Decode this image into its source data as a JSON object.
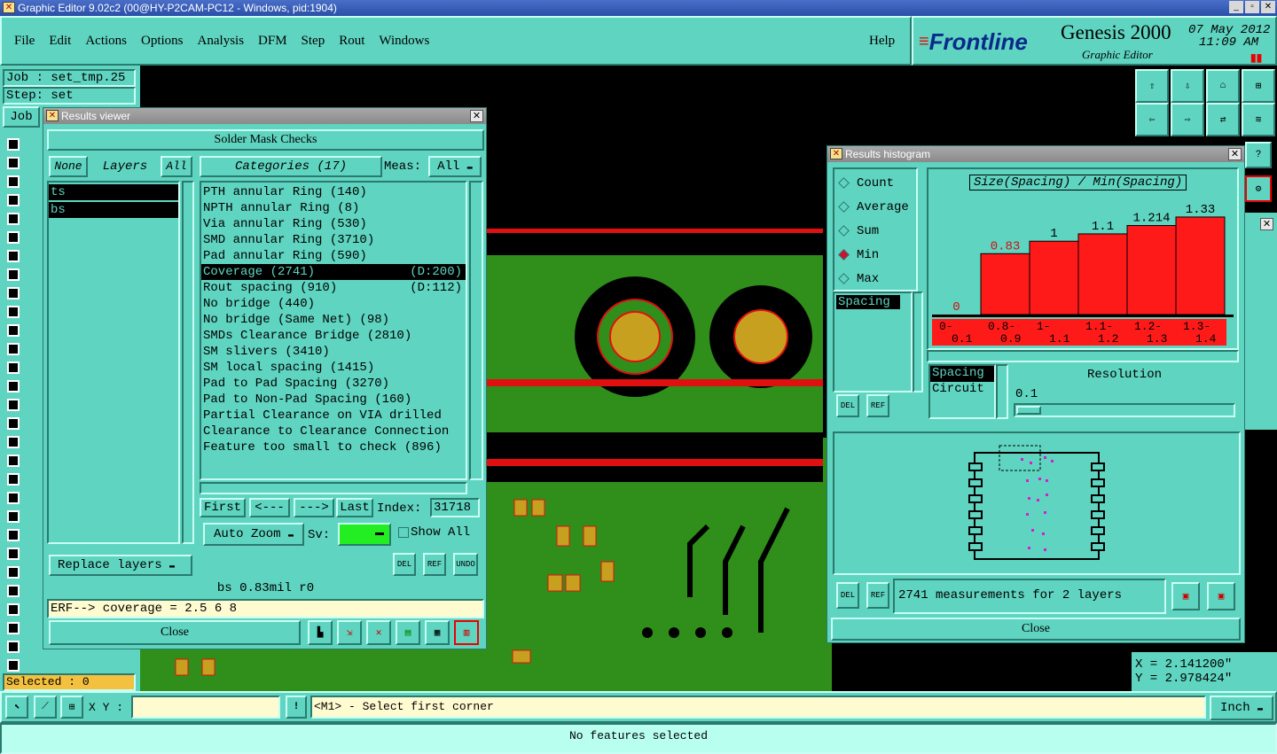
{
  "window_title": "Graphic Editor 9.02c2 (00@HY-P2CAM-PC12 - Windows, pid:1904)",
  "menu": [
    "File",
    "Edit",
    "Actions",
    "Options",
    "Analysis",
    "DFM",
    "Step",
    "Rout",
    "Windows"
  ],
  "help": "Help",
  "brand": {
    "logo": "Frontline",
    "product": "Genesis 2000",
    "subtitle": "Graphic Editor",
    "date": "07 May 2012",
    "time": "11:09 AM"
  },
  "job_label": "Job : set_tmp.25",
  "step_label": "Step: set",
  "job_btn": "Job",
  "selected": "Selected : 0",
  "coords": {
    "x": "X = 2.141200\"",
    "y": "Y = 2.978424\""
  },
  "results_viewer": {
    "title": "Results viewer",
    "header": "Solder Mask Checks",
    "none_btn": "None",
    "layers_label": "Layers",
    "all_btn": "All",
    "layers": [
      "ts",
      "bs"
    ],
    "categories_label": "Categories (17)",
    "meas_label": "Meas:",
    "meas_value": "All",
    "categories": [
      {
        "name": "PTH annular Ring (140)",
        "extra": ""
      },
      {
        "name": "NPTH annular Ring (8)",
        "extra": ""
      },
      {
        "name": "Via annular Ring (530)",
        "extra": ""
      },
      {
        "name": "SMD annular Ring (3710)",
        "extra": ""
      },
      {
        "name": "Pad annular Ring (590)",
        "extra": ""
      },
      {
        "name": "Coverage (2741)",
        "extra": "(D:200)"
      },
      {
        "name": "Rout spacing (910)",
        "extra": "(D:112)"
      },
      {
        "name": "No bridge (440)",
        "extra": ""
      },
      {
        "name": "No bridge (Same Net) (98)",
        "extra": ""
      },
      {
        "name": "SMDs Clearance Bridge (2810)",
        "extra": ""
      },
      {
        "name": "SM slivers (3410)",
        "extra": ""
      },
      {
        "name": "SM local spacing (1415)",
        "extra": ""
      },
      {
        "name": "Pad to Pad Spacing (3270)",
        "extra": ""
      },
      {
        "name": "Pad to Non-Pad Spacing (160)",
        "extra": ""
      },
      {
        "name": "Partial Clearance on VIA drilled",
        "extra": ""
      },
      {
        "name": "Clearance to Clearance Connection",
        "extra": ""
      },
      {
        "name": "Feature too small to check (896)",
        "extra": ""
      }
    ],
    "nav": {
      "first": "First",
      "prev": "<---",
      "next": "--->",
      "last": "Last",
      "index_label": "Index:",
      "index_value": "31718"
    },
    "auto_zoom": "Auto Zoom",
    "sv_label": "Sv:",
    "show_all": "Show All",
    "replace_layers": "Replace layers",
    "del": "DEL",
    "ref": "REF",
    "undo": "UNDO",
    "status": "bs 0.83mil  r0",
    "erf": "ERF--> coverage = 2.5 6 8",
    "close": "Close"
  },
  "histogram": {
    "title": "Results histogram",
    "modes": [
      {
        "label": "Count",
        "on": false
      },
      {
        "label": "Average",
        "on": false
      },
      {
        "label": "Sum",
        "on": false
      },
      {
        "label": "Min",
        "on": true
      },
      {
        "label": "Max",
        "on": false
      }
    ],
    "chart_title": "Size(Spacing) / Min(Spacing)",
    "list_item": "Spacing",
    "resolution_label": "Resolution",
    "resolution_value": "0.1",
    "types": [
      "Spacing",
      "Circuit"
    ],
    "measurements": "2741 measurements for 2 layers",
    "close": "Close"
  },
  "chart_data": {
    "type": "bar",
    "title": "Size(Spacing) / Min(Spacing)",
    "categories": [
      "0-\n0.1",
      "0.8-\n0.9",
      "1-\n1.1",
      "1.1-\n1.2",
      "1.2-\n1.3",
      "1.3-\n1.4"
    ],
    "values": [
      0,
      0.83,
      1,
      1.1,
      1.214,
      1.33
    ],
    "value_labels": [
      "0",
      "0.83",
      "1",
      "1.1",
      "1.214",
      "1.33"
    ],
    "ylim": [
      0,
      1.45
    ],
    "color": "#ff1a1a"
  },
  "bottom": {
    "xy_label": "X Y :",
    "prompt": "<M1> - Select first corner",
    "unit": "Inch",
    "status": "No features selected"
  }
}
